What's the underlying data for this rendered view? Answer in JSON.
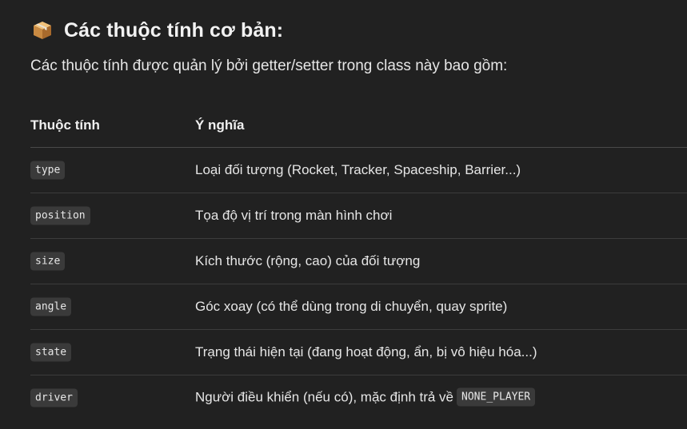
{
  "heading": {
    "icon": "package-icon",
    "text": "Các thuộc tính cơ bản:"
  },
  "intro": "Các thuộc tính được quản lý bởi getter/setter trong class này bao gồm:",
  "table": {
    "headers": [
      "Thuộc tính",
      "Ý nghĩa"
    ],
    "rows": [
      {
        "attr": "type",
        "meaning": "Loại đối tượng (Rocket, Tracker, Spaceship, Barrier...)"
      },
      {
        "attr": "position",
        "meaning": "Tọa độ vị trí trong màn hình chơi"
      },
      {
        "attr": "size",
        "meaning": "Kích thước (rộng, cao) của đối tượng"
      },
      {
        "attr": "angle",
        "meaning": "Góc xoay (có thể dùng trong di chuyển, quay sprite)"
      },
      {
        "attr": "state",
        "meaning": "Trạng thái hiện tại (đang hoạt động, ẩn, bị vô hiệu hóa...)"
      },
      {
        "attr": "driver",
        "meaning": "Người điều khiển (nếu có), mặc định trả về",
        "code": "NONE_PLAYER"
      }
    ]
  }
}
